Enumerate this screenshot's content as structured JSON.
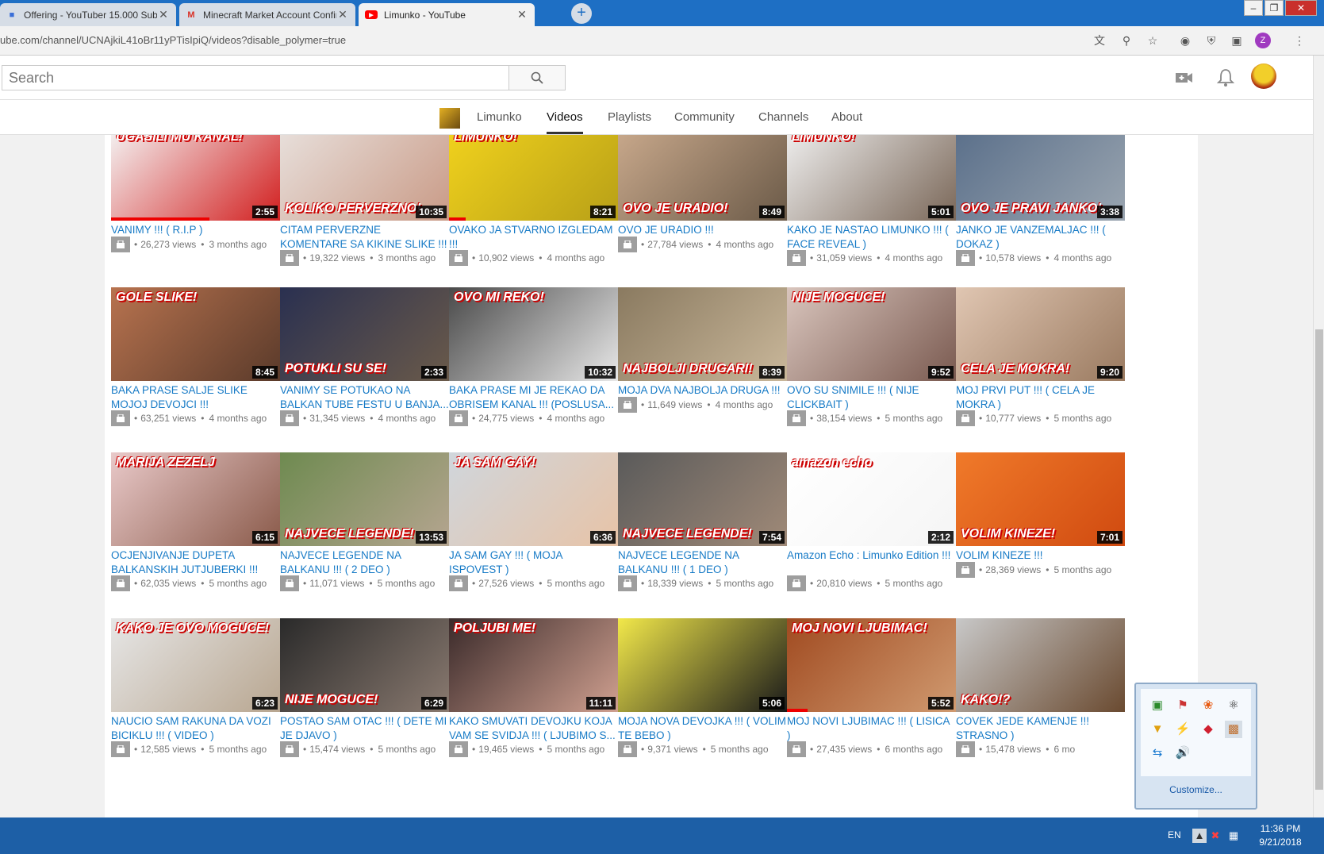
{
  "browser": {
    "tabs": [
      {
        "title": "Offering - YouTuber 15.000 Subs",
        "icon": "cube-icon",
        "color": "#3a6fd8"
      },
      {
        "title": "Minecraft Market Account Confir",
        "icon": "gmail-icon",
        "color": "#d93025"
      },
      {
        "title": "Limunko - YouTube",
        "icon": "youtube-icon",
        "color": "#ff0000"
      }
    ],
    "url": "ube.com/channel/UCNAjkiL41oBr11yPTisIpiQ/videos?disable_polymer=true",
    "profile_initial": "Z"
  },
  "masthead": {
    "search_placeholder": "Search"
  },
  "channel": {
    "tabs": [
      "Limunko",
      "Videos",
      "Playlists",
      "Community",
      "Channels",
      "About"
    ],
    "active_tab": "Videos"
  },
  "colors": {
    "link": "#167ac6",
    "meta": "#767676",
    "accent": "#e00000",
    "taskbar": "#1d5fa6"
  },
  "videos": [
    {
      "title": "VANIMY !!! ( R.I.P )",
      "views": "26,273 views",
      "age": "3 months ago",
      "duration": "2:55",
      "caption": "UGASILI MU KANAL!",
      "progress": 0.58,
      "bg": "#f4f4f4,#d21f1f"
    },
    {
      "title": "CITAM PERVERZNE KOMENTARE SA KIKINE SLIKE !!! ( OVO JOJ...",
      "views": "19,322 views",
      "age": "3 months ago",
      "duration": "10:35",
      "caption": "KOLIKO PERVERZNO!",
      "progress": 0,
      "bg": "#e8e0dc,#c99a86"
    },
    {
      "title": "OVAKO JA STVARNO IZGLEDAM !!!",
      "views": "10,902 views",
      "age": "4 months ago",
      "duration": "8:21",
      "caption": "LIMUNKO!",
      "progress": 0.1,
      "bg": "#f1d21d,#b8a017"
    },
    {
      "title": "OVO JE URADIO !!!",
      "views": "27,784 views",
      "age": "4 months ago",
      "duration": "8:49",
      "caption": "OVO JE URADIO!",
      "progress": 0,
      "bg": "#c9a98c,#6b5a48"
    },
    {
      "title": "KAKO JE NASTAO LIMUNKO !!! ( FACE REVEAL )",
      "views": "31,059 views",
      "age": "4 months ago",
      "duration": "5:01",
      "caption": "LIMUNKO!",
      "progress": 0,
      "bg": "#f0f0f0,#7a6758"
    },
    {
      "title": "JANKO JE VANZEMALJAC !!! ( DOKAZ )",
      "views": "10,578 views",
      "age": "4 months ago",
      "duration": "3:38",
      "caption": "OVO JE PRAVI JANKO!",
      "progress": 0,
      "bg": "#5a6f8a,#9aa5b0"
    },
    {
      "title": "BAKA PRASE SALJE SLIKE MOJOJ DEVOJCI !!!",
      "views": "63,251 views",
      "age": "4 months ago",
      "duration": "8:45",
      "caption": "GOLE SLIKE!",
      "progress": 0,
      "bg": "#b8734f,#5a3a2a"
    },
    {
      "title": "VANIMY SE POTUKAO NA BALKAN TUBE FESTU U BANJA...",
      "views": "31,345 views",
      "age": "4 months ago",
      "duration": "2:33",
      "caption": "POTUKLI SU SE!",
      "progress": 0,
      "bg": "#2a3050,#6a5a4a"
    },
    {
      "title": "BAKA PRASE MI JE REKAO DA OBRISEM KANAL !!! (POSLUSA...",
      "views": "24,775 views",
      "age": "4 months ago",
      "duration": "10:32",
      "caption": "OVO MI REKO!",
      "progress": 0,
      "bg": "#4a4a4a,#e8e8e8"
    },
    {
      "title": "MOJA DVA NAJBOLJA DRUGA !!!",
      "views": "11,649 views",
      "age": "4 months ago",
      "duration": "8:39",
      "caption": "NAJBOLJI DRUGARI!",
      "progress": 0,
      "bg": "#8a7a60,#c9b79a"
    },
    {
      "title": "OVO SU SNIMILE !!! ( NIJE CLICKBAIT )",
      "views": "38,154 views",
      "age": "5 months ago",
      "duration": "9:52",
      "caption": "NIJE MOGUCE!",
      "progress": 0,
      "bg": "#d9c5bd,#7a5a50"
    },
    {
      "title": "MOJ PRVI PUT !!! ( CELA JE MOKRA )",
      "views": "10,777 views",
      "age": "5 months ago",
      "duration": "9:20",
      "caption": "CELA JE MOKRA!",
      "progress": 0,
      "bg": "#e0c6b2,#9a7a60"
    },
    {
      "title": "OCJENJIVANJE DUPETA BALKANSKIH JUTJUBERKI !!!",
      "views": "62,035 views",
      "age": "5 months ago",
      "duration": "6:15",
      "caption": "MARIJA ZEZELJ",
      "progress": 0,
      "bg": "#e9c9c9,#8a5a4a"
    },
    {
      "title": "NAJVECE LEGENDE NA BALKANU !!! ( 2 DEO )",
      "views": "11,071 views",
      "age": "5 months ago",
      "duration": "13:53",
      "caption": "NAJVECE LEGENDE!",
      "progress": 0,
      "bg": "#6e8a50,#b5a590"
    },
    {
      "title": "JA SAM GAY !!! ( MOJA ISPOVEST )",
      "views": "27,526 views",
      "age": "5 months ago",
      "duration": "6:36",
      "caption": "JA SAM GAY!",
      "progress": 0,
      "bg": "#d0d6dc,#e7c3a7"
    },
    {
      "title": "NAJVECE LEGENDE NA BALKANU !!! ( 1 DEO )",
      "views": "18,339 views",
      "age": "5 months ago",
      "duration": "7:54",
      "caption": "NAJVECE LEGENDE!",
      "progress": 0,
      "bg": "#5a5a5a,#a08a78"
    },
    {
      "title": "Amazon Echo : Limunko Edition !!!",
      "views": "20,810 views",
      "age": "5 months ago",
      "duration": "2:12",
      "caption": "amazon echo",
      "progress": 0,
      "bg": "#ffffff,#f5f5f5"
    },
    {
      "title": "VOLIM KINEZE !!!",
      "views": "28,369 views",
      "age": "5 months ago",
      "duration": "7:01",
      "caption": "VOLIM KINEZE!",
      "progress": 0,
      "bg": "#f07a2a,#d04a10"
    },
    {
      "title": "NAUCIO SAM RAKUNA DA VOZI BICIKLU !!! ( VIDEO )",
      "views": "12,585 views",
      "age": "5 months ago",
      "duration": "6:23",
      "caption": "KAKO JE OVO MOGUCE!",
      "progress": 0,
      "bg": "#e6e6e6,#b8a690"
    },
    {
      "title": "POSTAO SAM OTAC !!! ( DETE MI JE DJAVO )",
      "views": "15,474 views",
      "age": "5 months ago",
      "duration": "6:29",
      "caption": "NIJE MOGUCE!",
      "progress": 0,
      "bg": "#2a2a2a,#8a7a70"
    },
    {
      "title": "KAKO SMUVATI DEVOJKU KOJA VAM SE SVIDJA !!! ( LJUBIMO S...",
      "views": "19,465 views",
      "age": "5 months ago",
      "duration": "11:11",
      "caption": "POLJUBI ME!",
      "progress": 0,
      "bg": "#3a2a2a,#d0a090"
    },
    {
      "title": "MOJA NOVA DEVOJKA !!! ( VOLIM TE BEBO )",
      "views": "9,371 views",
      "age": "5 months ago",
      "duration": "5:06",
      "caption": "",
      "progress": 0,
      "bg": "#f2e84a,#1a1a1a"
    },
    {
      "title": "MOJ NOVI LJUBIMAC !!! ( LISICA )",
      "views": "27,435 views",
      "age": "6 months ago",
      "duration": "5:52",
      "caption": "MOJ NOVI LJUBIMAC!",
      "progress": 0.12,
      "bg": "#a04a20,#d09a70"
    },
    {
      "title": "COVEK JEDE KAMENJE !!! STRASNO )",
      "views": "15,478 views",
      "age": "6 mo",
      "duration": "",
      "caption": "KAKO!?",
      "progress": 0,
      "bg": "#c8c8c8,#6a4a30"
    }
  ],
  "taskbar": {
    "lang": "EN",
    "time": "11:36 PM",
    "date": "9/21/2018"
  },
  "tray_popup": {
    "customize_label": "Customize..."
  }
}
